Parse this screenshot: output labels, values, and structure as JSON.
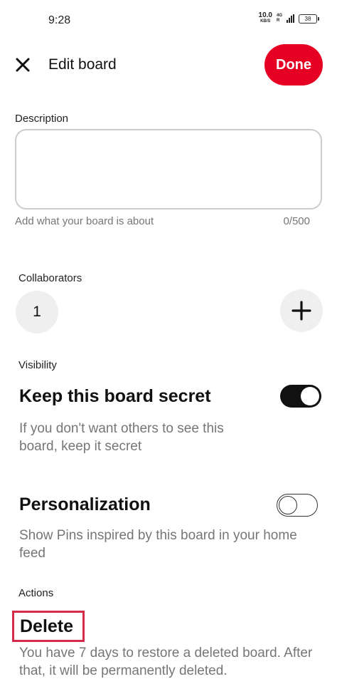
{
  "status_bar": {
    "time": "9:28",
    "net_speed_value": "10.0",
    "net_speed_unit": "KB/S",
    "net_type_top": "4G",
    "net_type_bottom": "R",
    "battery": "38"
  },
  "header": {
    "title": "Edit board",
    "done_label": "Done"
  },
  "description": {
    "label": "Description",
    "value": "",
    "hint": "Add what your board is about",
    "counter": "0/500"
  },
  "collaborators": {
    "label": "Collaborators",
    "count": "1"
  },
  "visibility": {
    "label": "Visibility",
    "secret_title": "Keep this board secret",
    "secret_desc": "If you don't want others to see this board, keep it secret",
    "secret_on": true
  },
  "personalization": {
    "title": "Personalization",
    "desc": "Show Pins inspired by this board in your home feed",
    "on": false
  },
  "actions": {
    "label": "Actions",
    "delete_label": "Delete",
    "delete_desc": "You have 7 days to restore a deleted board. After that, it will be permanently deleted."
  },
  "colors": {
    "accent": "#e60023",
    "highlight_border": "#d42b4a",
    "muted_text": "#767676"
  }
}
